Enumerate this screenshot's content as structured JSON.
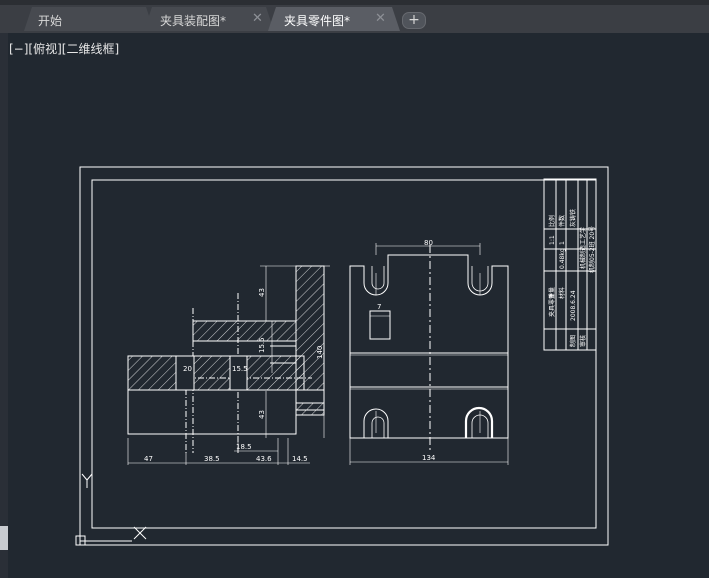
{
  "tabs": [
    {
      "label": "开始"
    },
    {
      "label": "夹具装配图*",
      "close": "✕"
    },
    {
      "label": "夹具零件图*",
      "close": "✕"
    }
  ],
  "add_tab": "+",
  "viewport": {
    "label": "[−][俯视][二维线框]"
  },
  "dimensions": {
    "top_width": "80",
    "bottom_width": "134",
    "height_140": "140",
    "dim_43_top": "43",
    "dim_43_bottom": "43",
    "dim_15_5_vert": "15.5",
    "dim_7": "7",
    "dim_20": "20",
    "dim_15_5": "15.5",
    "dim_18_5": "18.5",
    "dim_47": "47",
    "dim_38_5": "38.5",
    "dim_43_6": "43.6",
    "dim_14_5": "14.5"
  },
  "title_block": {
    "part_name": "夹具零件",
    "scale": "1:1",
    "weight": "0.48kg",
    "material": "灰铸铁",
    "count": "1",
    "school": "机械制造工艺学",
    "class_info": "机制05-2班 20号",
    "date": "2008.6.24",
    "drawn": "制图",
    "checked": "审核",
    "labels": [
      "比例",
      "件数",
      "重量",
      "材料"
    ]
  },
  "ucs": {
    "y": "Y",
    "x": "X"
  },
  "colors": {
    "background": "#212830",
    "lines": "#ffffff",
    "tabbar": "#3b3e44",
    "active_tab": "#55585f"
  }
}
